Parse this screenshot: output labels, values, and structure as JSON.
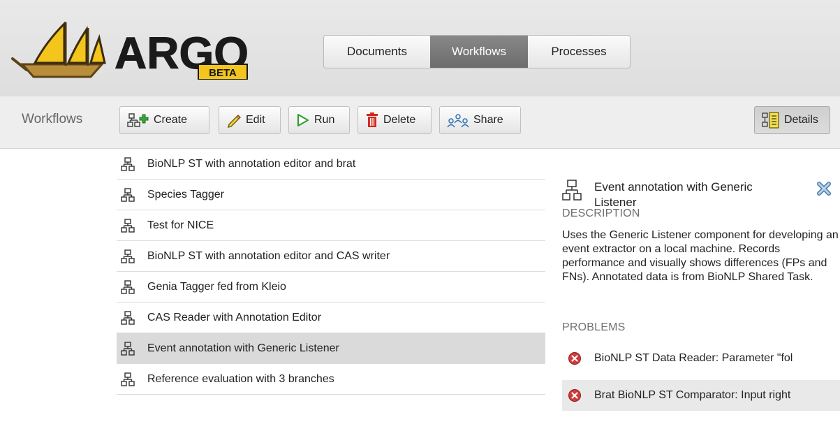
{
  "app": {
    "logo_text": "ARGO",
    "logo_badge": "BETA"
  },
  "nav": {
    "tabs": [
      {
        "label": "Documents",
        "active": false
      },
      {
        "label": "Workflows",
        "active": true
      },
      {
        "label": "Processes",
        "active": false
      }
    ]
  },
  "toolbar": {
    "title": "Workflows",
    "create_label": "Create",
    "edit_label": "Edit",
    "run_label": "Run",
    "delete_label": "Delete",
    "share_label": "Share",
    "details_label": "Details"
  },
  "workflows": {
    "items": [
      {
        "label": "BioNLP ST with annotation editor and brat",
        "selected": false
      },
      {
        "label": "Species Tagger",
        "selected": false
      },
      {
        "label": "Test for NICE",
        "selected": false
      },
      {
        "label": "BioNLP ST with annotation editor and CAS writer",
        "selected": false
      },
      {
        "label": "Genia Tagger fed from Kleio",
        "selected": false
      },
      {
        "label": "CAS Reader with Annotation Editor",
        "selected": false
      },
      {
        "label": "Event annotation with Generic Listener",
        "selected": true
      },
      {
        "label": "Reference evaluation with 3 branches",
        "selected": false
      }
    ]
  },
  "details": {
    "title": "Event annotation with Generic Listener",
    "description_heading": "DESCRIPTION",
    "description": "Uses the Generic Listener component for developing an event extractor on a local machine. Records performance and visually shows differences (FPs and FNs). Annotated data is from BioNLP Shared Task.",
    "problems_heading": "PROBLEMS",
    "problems": [
      {
        "text": "BioNLP ST Data Reader: Parameter \"fol"
      },
      {
        "text": "Brat BioNLP ST Comparator: Input right"
      }
    ]
  },
  "colors": {
    "active_tab": "#7a7a7a",
    "logo_sail": "#f3c51d",
    "logo_hull": "#b98e3a",
    "delete_red": "#d02a1d",
    "create_green": "#3aa53a",
    "error_red": "#d23a3a",
    "selection": "#dadada"
  }
}
